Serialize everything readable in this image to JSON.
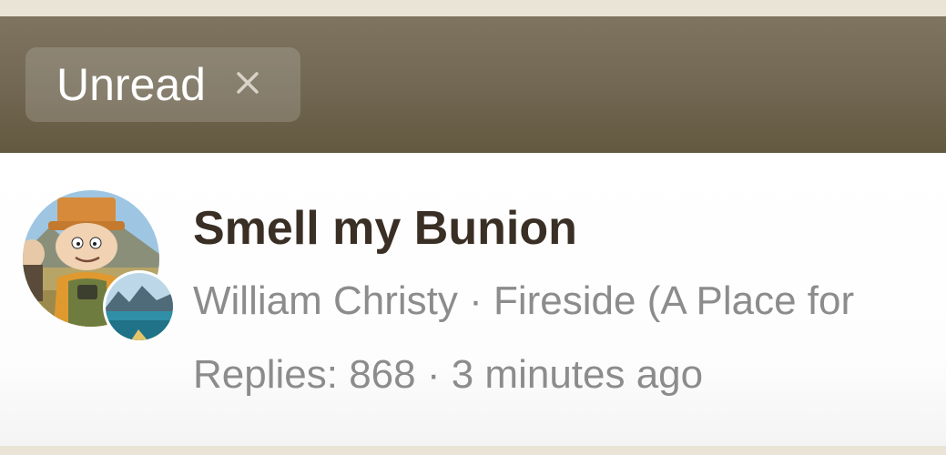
{
  "filter": {
    "chip_label": "Unread",
    "close_glyph": "×",
    "close_icon": "close-icon"
  },
  "topic": {
    "title": "Smell my Bunion",
    "author": "William Christy",
    "separator": " · ",
    "category": "Fireside (A Place for",
    "replies_label": "Replies: 868",
    "time_ago": "3 minutes ago",
    "avatar_icon": "user-avatar",
    "category_avatar_icon": "category-avatar"
  },
  "colors": {
    "bar_top": "#7e7460",
    "bar_bottom": "#63593f",
    "title": "#3a2f25",
    "meta": "#8c8c8c",
    "strip": "#e9e4d6"
  }
}
